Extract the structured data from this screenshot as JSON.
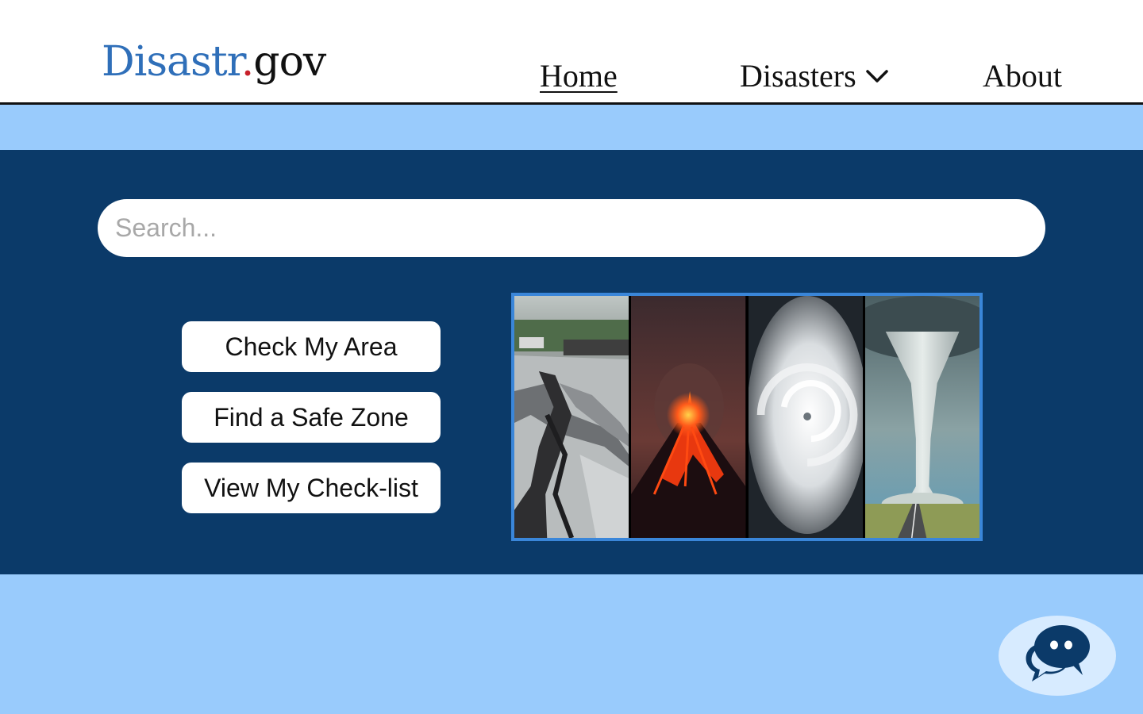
{
  "logo": {
    "brand": "Disastr",
    "dot": ".",
    "tld": "gov"
  },
  "nav": {
    "home": "Home",
    "disasters": "Disasters",
    "about": "About"
  },
  "search": {
    "placeholder": "Search..."
  },
  "actions": [
    "Check My Area",
    "Find a Safe Zone",
    "View My Check-list"
  ],
  "collage": {
    "panels": [
      "earthquake",
      "volcano",
      "hurricane",
      "tornado"
    ]
  },
  "icons": {
    "disasters_dropdown": "chevron-down-icon",
    "chat": "chat-bubbles-icon"
  },
  "colors": {
    "header_bg": "#ffffff",
    "band": "#99cbfc",
    "hero": "#0b3a69",
    "logo_blue": "#2f6fb9",
    "logo_dot": "#c8202a",
    "collage_border": "#3a86d9",
    "chat_bubble": "#0b3a69",
    "chat_bg": "#d7ebff"
  }
}
